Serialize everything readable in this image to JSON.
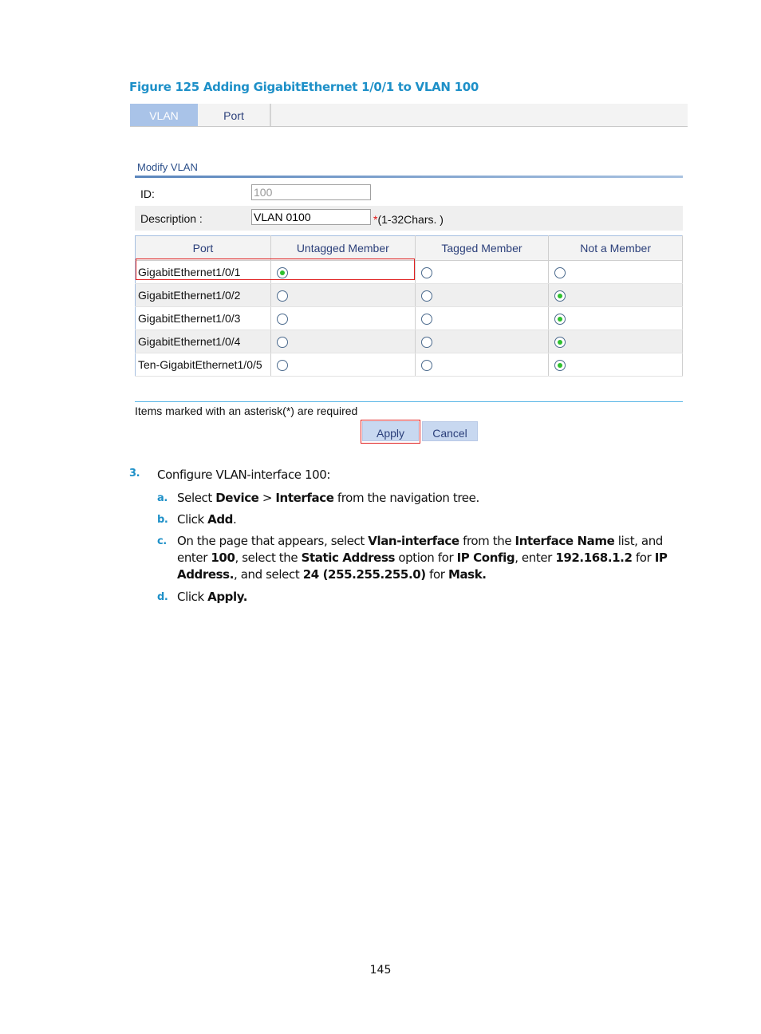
{
  "figure_caption": "Figure 125 Adding GigabitEthernet 1/0/1 to VLAN 100",
  "tabs": [
    {
      "label": "VLAN",
      "active": true
    },
    {
      "label": "Port",
      "active": false
    }
  ],
  "section_title": "Modify VLAN",
  "form": {
    "id_label": "ID:",
    "id_value": "100",
    "description_label": "Description :",
    "description_value": "VLAN 0100",
    "asterisk": "*",
    "description_hint": "(1-32Chars. )"
  },
  "table": {
    "headers": [
      "Port",
      "Untagged Member",
      "Tagged Member",
      "Not a Member"
    ],
    "rows": [
      {
        "port": "GigabitEthernet1/0/1",
        "selection": "Untagged Member"
      },
      {
        "port": "GigabitEthernet1/0/2",
        "selection": "Not a Member"
      },
      {
        "port": "GigabitEthernet1/0/3",
        "selection": "Not a Member"
      },
      {
        "port": "GigabitEthernet1/0/4",
        "selection": "Not a Member"
      },
      {
        "port": "Ten-GigabitEthernet1/0/5",
        "selection": "Not a Member"
      }
    ]
  },
  "required_note": "Items marked with an asterisk(*) are required",
  "buttons": {
    "apply": "Apply",
    "cancel": "Cancel"
  },
  "steps": {
    "step3": {
      "num": "3.",
      "text": "Configure VLAN-interface 100:"
    },
    "a": {
      "num": "a.",
      "parts": [
        "Select ",
        "Device",
        " > ",
        "Interface",
        " from the navigation tree."
      ]
    },
    "b": {
      "num": "b.",
      "parts": [
        "Click ",
        "Add",
        "."
      ]
    },
    "c": {
      "num": "c.",
      "parts": [
        "On the page that appears, select ",
        "Vlan-interface",
        " from the ",
        "Interface Name",
        " list, and enter ",
        "100",
        ", select the ",
        "Static Address",
        " option for ",
        "IP Config",
        ", enter ",
        "192.168.1.2",
        " for ",
        "IP Address.",
        ", and select ",
        "24 (255.255.255.0)",
        " for ",
        "Mask."
      ]
    },
    "d": {
      "num": "d.",
      "parts": [
        "Click ",
        "Apply."
      ]
    }
  },
  "page_number": "145",
  "colors": {
    "accent": "#1e90c8",
    "highlight": "#e02020",
    "radio_selected": "#2ec02e",
    "tab_active": "#a9c3e8"
  }
}
